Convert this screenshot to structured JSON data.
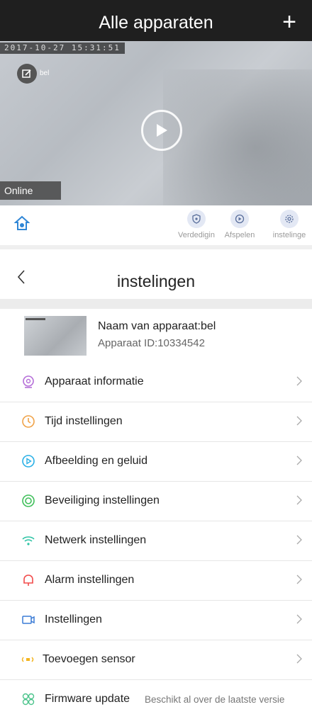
{
  "header": {
    "title": "Alle apparaten",
    "add_symbol": "+"
  },
  "camera": {
    "timestamp": "2017-10-27 15:31:51",
    "name": "bel",
    "status": "Online"
  },
  "actions": [
    {
      "label": "Verdedigin",
      "icon": "shield-icon"
    },
    {
      "label": "Afspelen",
      "icon": "playback-icon"
    },
    {
      "label": "instelinge",
      "icon": "gear-icon"
    }
  ],
  "settings": {
    "title": "instelingen",
    "device_name": "Naam van apparaat:bel",
    "device_id": "Apparaat ID:10334542"
  },
  "menu": [
    {
      "label": "Apparaat informatie",
      "icon": "camera-info-icon",
      "color": "#b56fd8"
    },
    {
      "label": "Tijd instellingen",
      "icon": "clock-icon",
      "color": "#f0a247"
    },
    {
      "label": "Afbeelding en geluid",
      "icon": "play-circle-icon",
      "color": "#2ab0e6"
    },
    {
      "label": "Beveiliging instellingen",
      "icon": "lifebuoy-icon",
      "color": "#3fbf5a"
    },
    {
      "label": "Netwerk instellingen",
      "icon": "wifi-icon",
      "color": "#2cc3a4"
    },
    {
      "label": "Alarm instellingen",
      "icon": "bell-icon",
      "color": "#f24b4b"
    },
    {
      "label": "Instellingen",
      "icon": "video-camera-icon",
      "color": "#3a7bd5"
    },
    {
      "label": "Toevoegen sensor",
      "icon": "sensor-icon",
      "color": "#f3b41f"
    },
    {
      "label": "Firmware update",
      "icon": "firmware-icon",
      "color": "#4cc48c",
      "note": "Beschikt al over de laatste versie"
    }
  ]
}
